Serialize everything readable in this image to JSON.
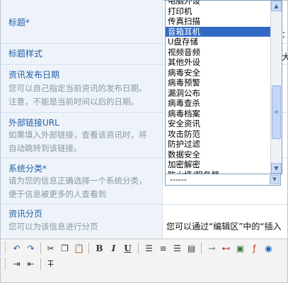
{
  "form": {
    "rows": [
      {
        "label": "标题*",
        "desc": ""
      },
      {
        "label": "标题样式",
        "desc": ""
      },
      {
        "label": "资讯发布日期",
        "desc1": "您可以自己指定当前资讯的发布日期。",
        "desc2": "注意，不能是当前时间以后的日期。"
      },
      {
        "label": "外部链接URL",
        "desc1": "如果填入外部链接，查看该资讯时，将",
        "desc2": "自动跳转到该链接。"
      },
      {
        "label": "系统分类*",
        "desc1": "请为您的信息正确选择一个系统分类，",
        "desc2": "便于信息被更多的人查看到"
      },
      {
        "label": "资讯分页",
        "desc1": "您可以为该信息进行分页",
        "desc2": ""
      }
    ],
    "category_dropdown": {
      "options": [
        "电脑外设",
        "打印机",
        "传真扫描",
        "音箱耳机",
        "U盘存储",
        "视频音频",
        "其他外设",
        "病毒安全",
        "病毒预警",
        "漏洞公布",
        "病毒查杀",
        "病毒档案",
        "安全资讯",
        "攻击防范",
        "防护过滤",
        "数据安全",
        "加密解密",
        "防火墙/服务器"
      ],
      "selected_index": 3,
      "selected_value": "------"
    },
    "pagination_hint": "您可以通过“编辑区”中的“插入",
    "right_stubs": [
      "：",
      "大"
    ]
  },
  "toolbar": {
    "icons": [
      "undo-icon",
      "redo-icon",
      "cut-icon",
      "copy-icon",
      "paste-icon",
      "bold-icon",
      "italic-icon",
      "underline-icon",
      "align-left-icon",
      "align-center-icon",
      "align-right-icon",
      "justify-icon",
      "link-icon",
      "unlink-icon",
      "image-icon",
      "flash-icon",
      "media-icon",
      "indent-icon",
      "outdent-icon",
      "strikethrough-icon"
    ],
    "bold_label": "B",
    "italic_label": "I",
    "underline_label": "U"
  }
}
